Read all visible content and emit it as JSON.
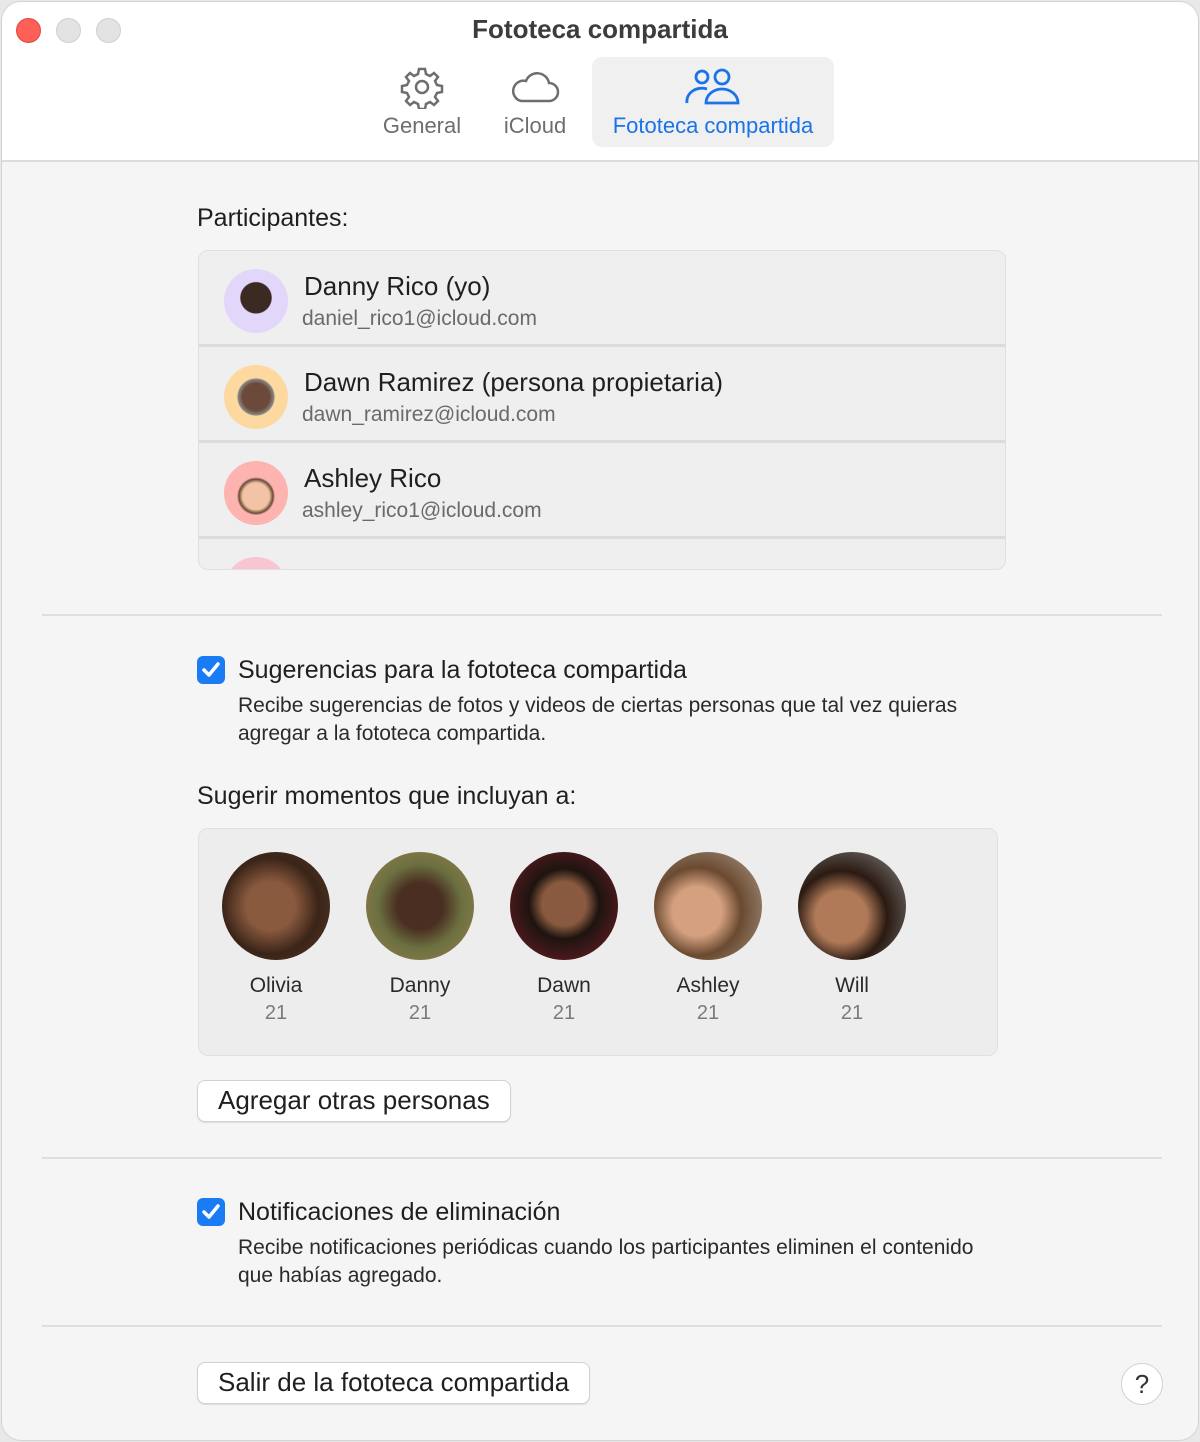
{
  "window": {
    "title": "Fototeca compartida"
  },
  "tabs": [
    {
      "label": "General",
      "icon": "gear-icon"
    },
    {
      "label": "iCloud",
      "icon": "cloud-icon"
    },
    {
      "label": "Fototeca compartida",
      "icon": "people-icon",
      "active": true
    }
  ],
  "participants": {
    "label": "Participantes:",
    "items": [
      {
        "name": "Danny Rico (yo)",
        "email": "daniel_rico1@icloud.com",
        "color": "#e2d6fb"
      },
      {
        "name": "Dawn Ramirez (persona propietaria)",
        "email": "dawn_ramirez@icloud.com",
        "color": "#fdd9a0"
      },
      {
        "name": "Ashley Rico",
        "email": "ashley_rico1@icloud.com",
        "color": "#fdb3b0"
      }
    ]
  },
  "suggestions": {
    "checked": true,
    "title": "Sugerencias para la fototeca compartida",
    "description": "Recibe sugerencias de fotos y videos de ciertas personas que tal vez quieras agregar a la fototeca compartida."
  },
  "moments": {
    "label": "Sugerir momentos que incluyan a:",
    "people": [
      {
        "name": "Olivia",
        "count": "21"
      },
      {
        "name": "Danny",
        "count": "21"
      },
      {
        "name": "Dawn",
        "count": "21"
      },
      {
        "name": "Ashley",
        "count": "21"
      },
      {
        "name": "Will",
        "count": "21"
      }
    ],
    "add_button": "Agregar otras personas"
  },
  "deletion": {
    "checked": true,
    "title": "Notificaciones de eliminación",
    "description": "Recibe notificaciones periódicas cuando los participantes eliminen el contenido que habías agregado."
  },
  "footer": {
    "leave_button": "Salir de la fototeca compartida",
    "help": "?"
  },
  "colors": {
    "accent": "#1a7cf5",
    "close": "#fe5f57"
  }
}
